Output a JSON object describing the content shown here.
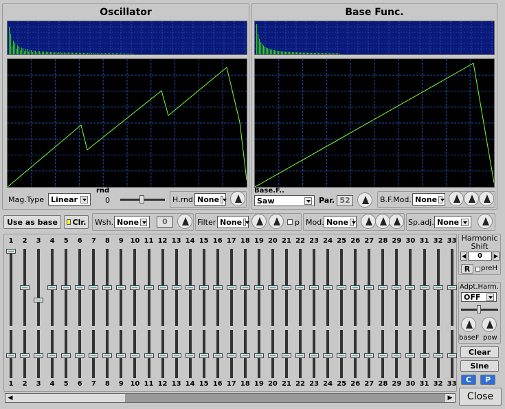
{
  "oscillator": {
    "title": "Oscillator",
    "mag_type_label": "Mag.Type",
    "mag_type_value": "Linear",
    "rnd_label": "rnd",
    "rnd_value": "0",
    "hrnd_label": "H.rnd",
    "hrnd_value": "None"
  },
  "base_func": {
    "title": "Base Func.",
    "base_label": "Base.F..",
    "base_value": "Saw",
    "par_label": "Par.",
    "par_value": "52",
    "bfmod_label": "B.F.Mod.",
    "bfmod_value": "None"
  },
  "toolbar": {
    "use_as_base": "Use as base",
    "clr": "Clr.",
    "wsh_label": "Wsh.",
    "wsh_value": "None",
    "wsh_amount": "0",
    "filter_label": "Filter",
    "filter_value": "None",
    "filter_p": "p",
    "mod_label": "Mod.",
    "mod_value": "None",
    "spadj_label": "Sp.adj.",
    "spadj_value": "None"
  },
  "harmonics": {
    "numbers": [
      "1",
      "2",
      "3",
      "4",
      "5",
      "6",
      "7",
      "8",
      "9",
      "10",
      "11",
      "12",
      "13",
      "14",
      "15",
      "16",
      "17",
      "18",
      "19",
      "20",
      "21",
      "22",
      "23",
      "24",
      "25",
      "26",
      "27",
      "28",
      "29",
      "30",
      "31",
      "32",
      "33"
    ],
    "magnitude_levels": [
      1.0,
      0.5,
      0.33,
      0.5,
      0.5,
      0.5,
      0.5,
      0.5,
      0.5,
      0.5,
      0.5,
      0.5,
      0.5,
      0.5,
      0.5,
      0.5,
      0.5,
      0.5,
      0.5,
      0.5,
      0.5,
      0.5,
      0.5,
      0.5,
      0.5,
      0.5,
      0.5,
      0.5,
      0.5,
      0.5,
      0.5,
      0.5,
      0.5
    ]
  },
  "side": {
    "harmonic_shift_label": "Harmonic Shift",
    "shift_value": "0",
    "r_label": "R",
    "preh_label": "preH",
    "adpt_label": "Adpt.Harm.",
    "adpt_value": "OFF",
    "basef_label": "baseF",
    "pow_label": "pow",
    "clear": "Clear",
    "sine": "Sine",
    "c": "C",
    "p": "P",
    "close": "Close"
  },
  "colors": {
    "wave": "#7dff3c",
    "grid": "#1f4fae",
    "spectrum_bg": "#0a1a7a",
    "spectrum_bar": "#34c81e"
  }
}
